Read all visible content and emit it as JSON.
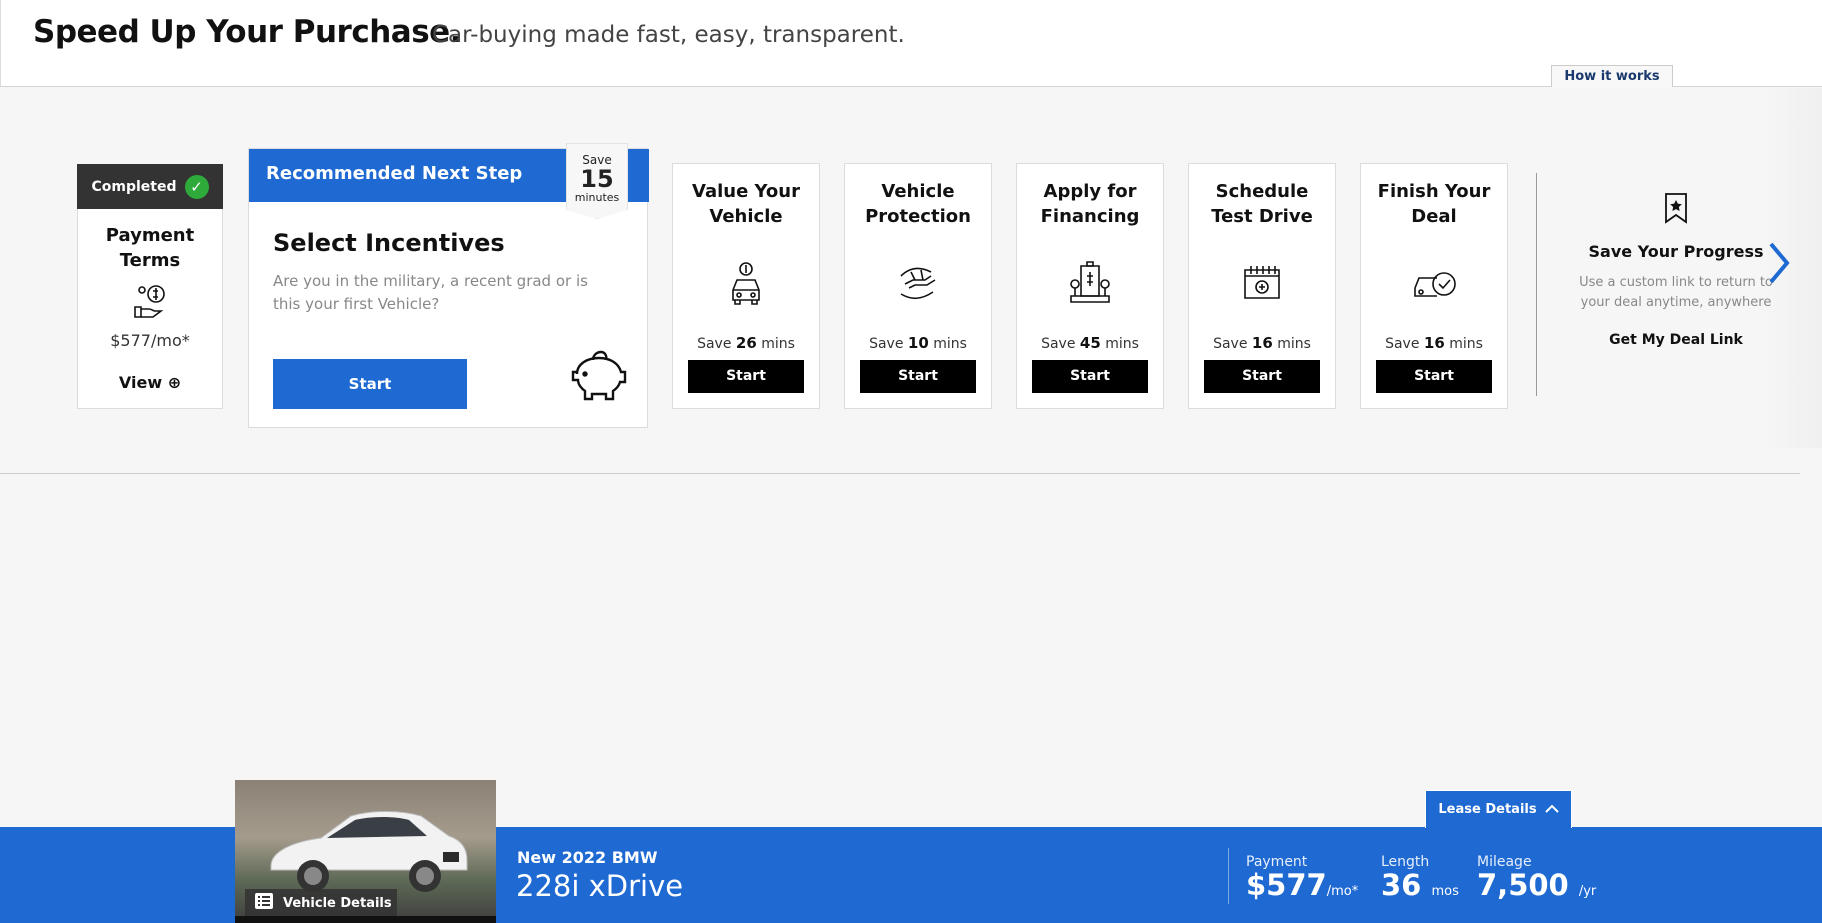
{
  "header": {
    "title": "Speed Up Your Purchase.",
    "subtitle": "Car-buying made fast, easy, transparent.",
    "how_it_works": "How it works"
  },
  "completed_step": {
    "badge": "Completed",
    "name": "Payment Terms",
    "price": "$577/mo*",
    "view_label": "View",
    "icon": "money-hand-icon"
  },
  "recommended": {
    "bar_label": "Recommended Next Step",
    "save_prefix": "Save",
    "save_value": "15",
    "save_unit": "minutes",
    "title": "Select Incentives",
    "description": "Are you in the military, a recent grad or is this your first Vehicle?",
    "start_label": "Start",
    "icon": "piggy-bank-icon"
  },
  "steps": [
    {
      "name": "Value Your Vehicle",
      "save_prefix": "Save",
      "minutes": "26",
      "unit": "mins",
      "start": "Start",
      "icon": "car-value-icon"
    },
    {
      "name": "Vehicle Protection",
      "save_prefix": "Save",
      "minutes": "10",
      "unit": "mins",
      "start": "Start",
      "icon": "protection-hands-icon"
    },
    {
      "name": "Apply for Financing",
      "save_prefix": "Save",
      "minutes": "45",
      "unit": "mins",
      "start": "Start",
      "icon": "bank-icon"
    },
    {
      "name": "Schedule Test Drive",
      "save_prefix": "Save",
      "minutes": "16",
      "unit": "mins",
      "start": "Start",
      "icon": "calendar-icon"
    },
    {
      "name": "Finish Your Deal",
      "save_prefix": "Save",
      "minutes": "16",
      "unit": "mins",
      "start": "Start",
      "icon": "car-check-icon"
    }
  ],
  "save_progress": {
    "title": "Save Your Progress",
    "description": "Use a custom link to return to your deal anytime, anywhere",
    "link": "Get My Deal Link"
  },
  "footer": {
    "vehicle_details": "Vehicle Details",
    "make": "New 2022 BMW",
    "model": "228i xDrive",
    "lease_details": "Lease Details",
    "payment_label": "Payment",
    "payment_value": "$577",
    "payment_unit": "/mo*",
    "length_label": "Length",
    "length_value": "36",
    "length_unit": "mos",
    "mileage_label": "Mileage",
    "mileage_value": "7,500",
    "mileage_unit": "/yr"
  },
  "colors": {
    "accent": "#1e69d2",
    "completed": "#2eaa3a"
  }
}
